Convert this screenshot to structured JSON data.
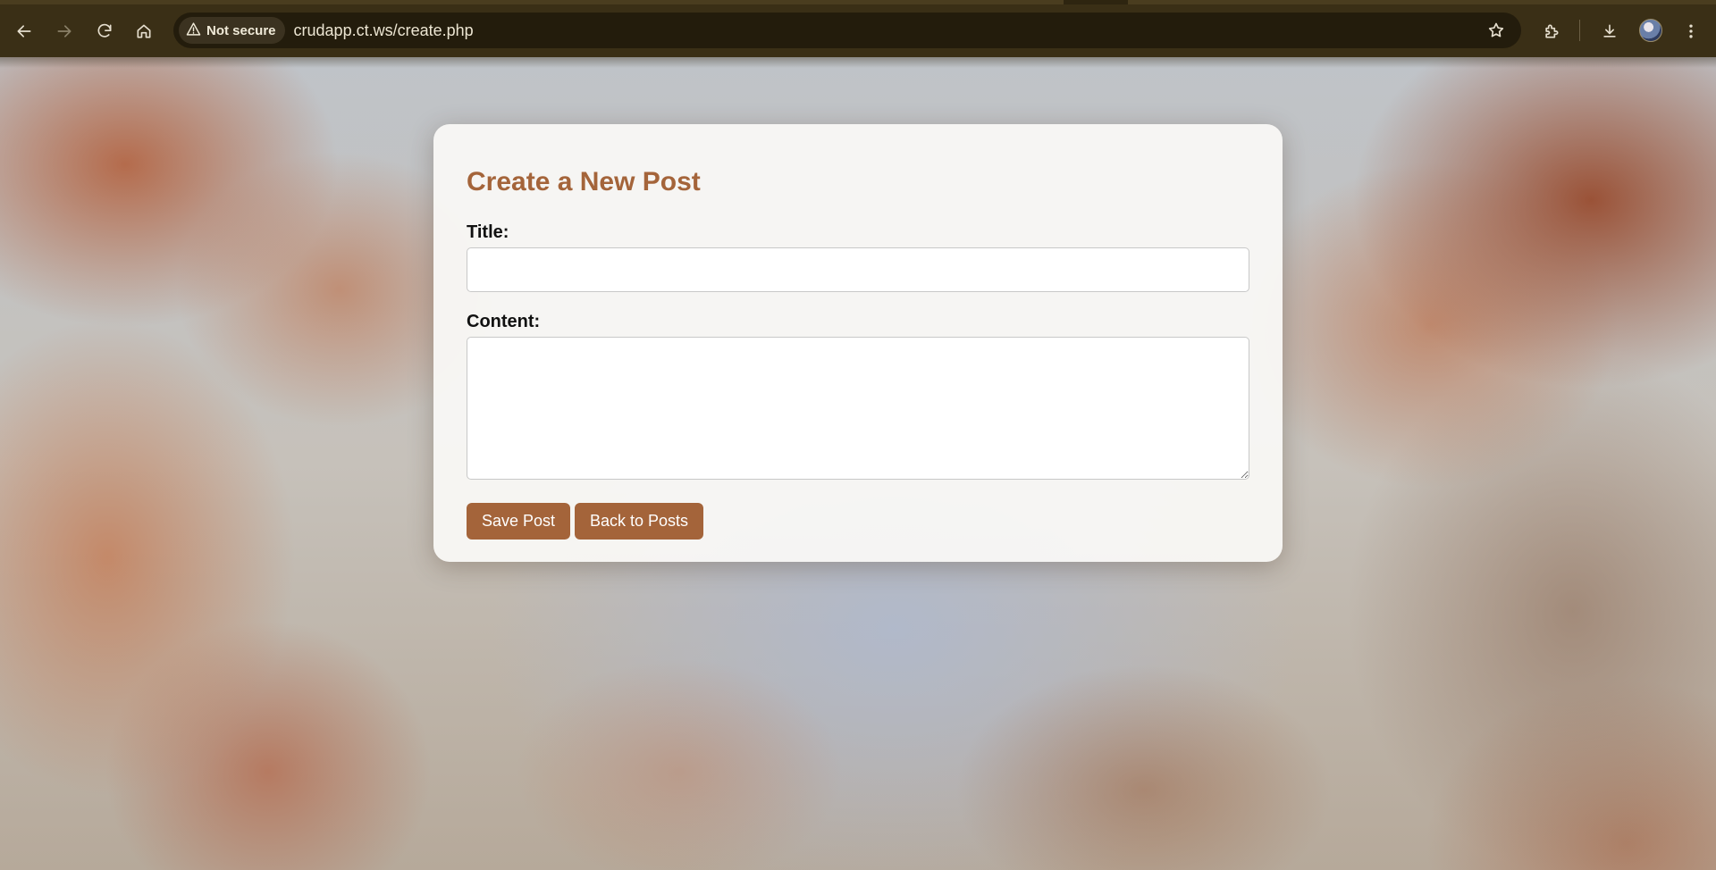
{
  "browser": {
    "security_label": "Not secure",
    "url": "crudapp.ct.ws/create.php"
  },
  "page": {
    "heading": "Create a New Post",
    "title_label": "Title:",
    "title_value": "",
    "content_label": "Content:",
    "content_value": "",
    "save_button": "Save Post",
    "back_button": "Back to Posts"
  },
  "colors": {
    "accent": "#a4643a",
    "chrome": "#3a2f16"
  }
}
